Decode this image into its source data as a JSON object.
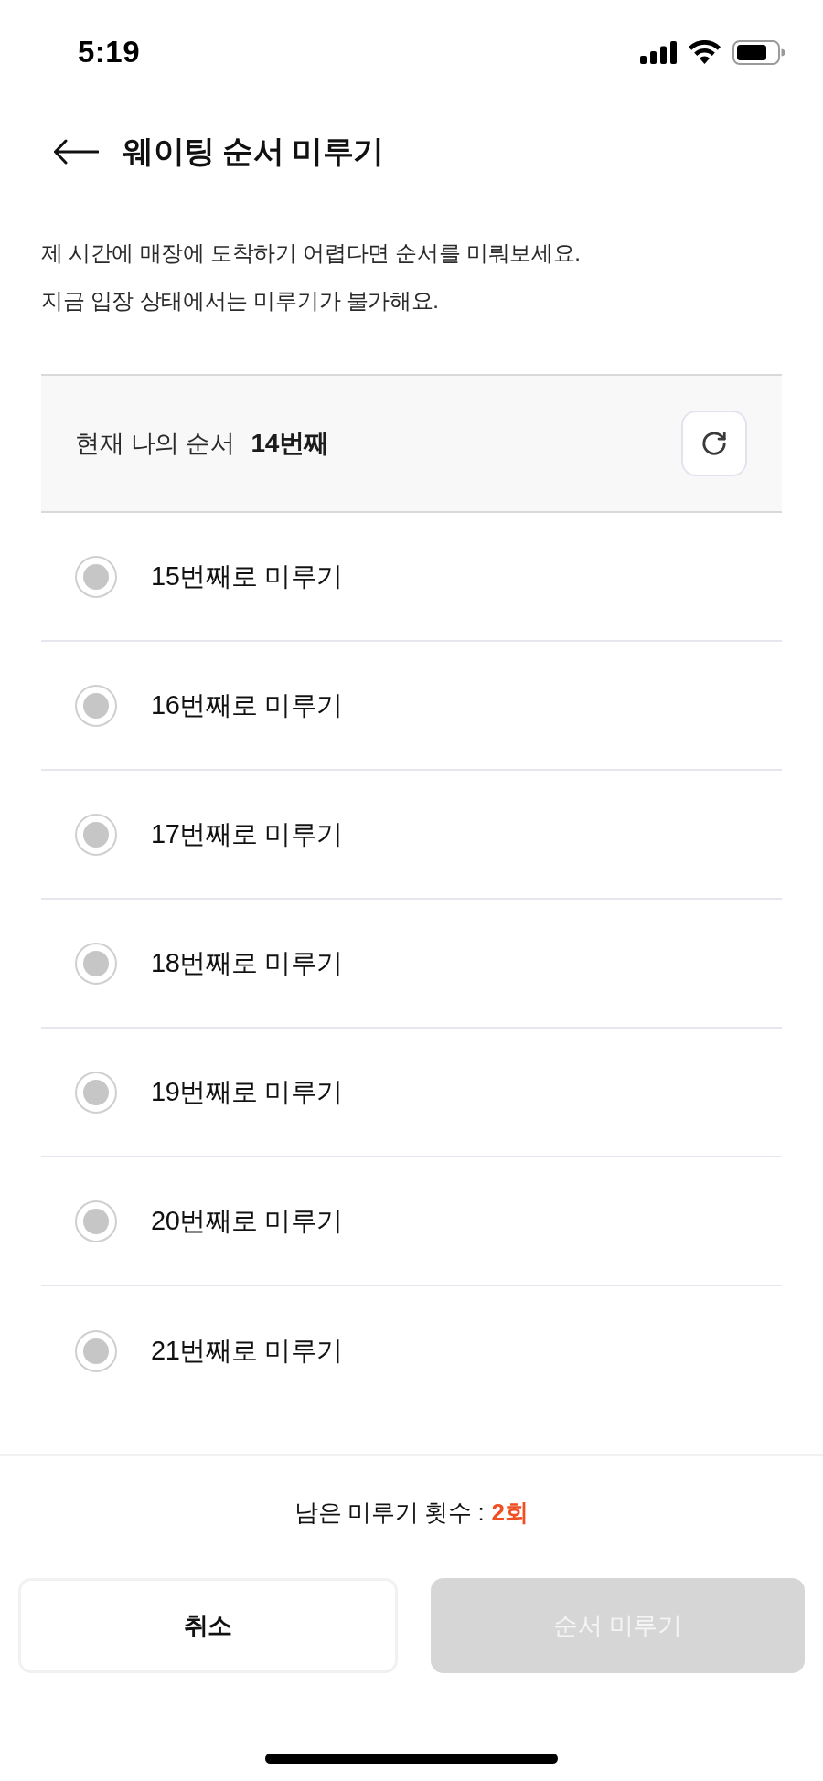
{
  "status_bar": {
    "time": "5:19"
  },
  "header": {
    "title": "웨이팅 순서 미루기"
  },
  "description": [
    "제 시간에 매장에 도착하기 어렵다면 순서를 미뤄보세요.",
    "지금 입장 상태에서는 미루기가 불가해요."
  ],
  "current_order": {
    "label": "현재 나의 순서",
    "value": "14번째"
  },
  "options": [
    {
      "label": "15번째로 미루기",
      "selected": false,
      "disabled": true
    },
    {
      "label": "16번째로 미루기",
      "selected": false,
      "disabled": true
    },
    {
      "label": "17번째로 미루기",
      "selected": false,
      "disabled": true
    },
    {
      "label": "18번째로 미루기",
      "selected": false,
      "disabled": true
    },
    {
      "label": "19번째로 미루기",
      "selected": false,
      "disabled": true
    },
    {
      "label": "20번째로 미루기",
      "selected": false,
      "disabled": true
    },
    {
      "label": "21번째로 미루기",
      "selected": false,
      "disabled": true
    }
  ],
  "remaining": {
    "label": "남은 미루기 횟수 :",
    "value": "2회"
  },
  "buttons": [
    {
      "kind": "secondary",
      "label": "취소",
      "disabled": false
    },
    {
      "kind": "primary",
      "label": "순서 미루기",
      "disabled": true
    }
  ]
}
